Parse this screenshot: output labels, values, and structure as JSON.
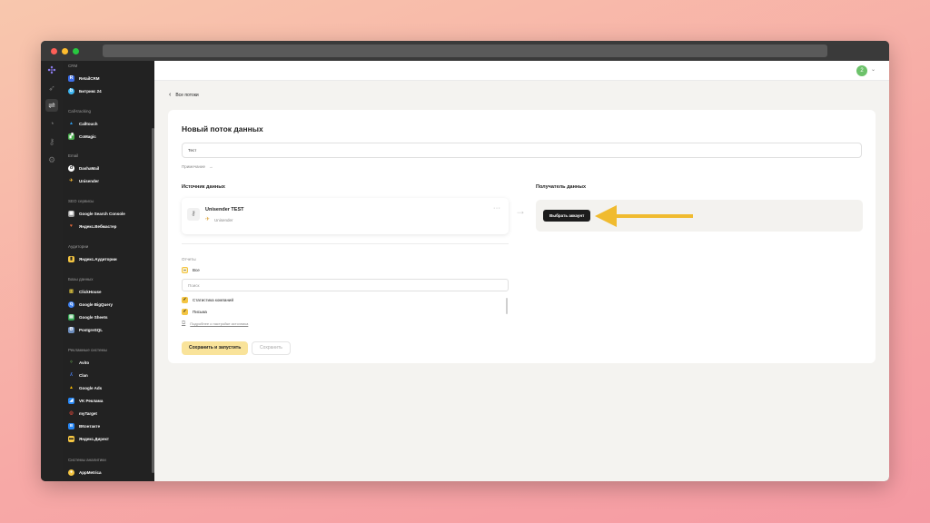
{
  "sidebar": {
    "groups": [
      {
        "title": "CRM",
        "items": [
          {
            "label": "RetailCRM",
            "icon": "retailcrm-icon",
            "color": "#3e6fe8"
          },
          {
            "label": "Битрикс 24",
            "icon": "bitrix24-icon",
            "color": "#3db6f2"
          }
        ]
      },
      {
        "title": "Call-tracking",
        "items": [
          {
            "label": "Calltouch",
            "icon": "calltouch-icon",
            "color": "#2f9be9"
          },
          {
            "label": "CoMagic",
            "icon": "comagic-icon",
            "color": "#4caf50"
          }
        ]
      },
      {
        "title": "Email",
        "items": [
          {
            "label": "DashaMail",
            "icon": "dashamail-icon",
            "color": "#ffffff"
          },
          {
            "label": "Unisender",
            "icon": "unisender-icon",
            "color": "#f2b632"
          }
        ]
      },
      {
        "title": "SEO сервисы",
        "items": [
          {
            "label": "Google Search Console",
            "icon": "google-search-console-icon",
            "color": "#9e9e9e"
          },
          {
            "label": "Яндекс.Вебмастер",
            "icon": "yandex-webmaster-icon",
            "color": "#e96a3b"
          }
        ]
      },
      {
        "title": "Аудитории",
        "items": [
          {
            "label": "Яндекс.Аудитории",
            "icon": "yandex-audience-icon",
            "color": "#f4c542"
          }
        ]
      },
      {
        "title": "Базы данных",
        "items": [
          {
            "label": "ClickHouse",
            "icon": "clickhouse-icon",
            "color": "#f4d742"
          },
          {
            "label": "Google BigQuery",
            "icon": "google-bigquery-icon",
            "color": "#4285f4"
          },
          {
            "label": "Google Sheets",
            "icon": "google-sheets-icon",
            "color": "#34a853"
          },
          {
            "label": "PostgreSQL",
            "icon": "postgresql-icon",
            "color": "#6f8fbf"
          }
        ]
      },
      {
        "title": "Рекламные системы",
        "items": [
          {
            "label": "Avito",
            "icon": "avito-icon",
            "color": "#72c05a"
          },
          {
            "label": "Clan",
            "icon": "clan-icon",
            "color": "#4a7dea"
          },
          {
            "label": "Google Ads",
            "icon": "google-ads-icon",
            "color": "#fbbc04"
          },
          {
            "label": "VK Реклама",
            "icon": "vk-ads-icon",
            "color": "#2787f5"
          },
          {
            "label": "myTarget",
            "icon": "mytarget-icon",
            "color": "#e94b3c"
          },
          {
            "label": "ВКонтакте",
            "icon": "vkontakte-icon",
            "color": "#2787f5"
          },
          {
            "label": "Яндекс.Директ",
            "icon": "yandex-direct-icon",
            "color": "#f4c542"
          }
        ]
      },
      {
        "title": "Системы аналитики",
        "items": [
          {
            "label": "AppMetrica",
            "icon": "appmetrica-icon",
            "color": "#f4c542"
          }
        ]
      }
    ]
  },
  "header": {
    "avatar_initial": "2"
  },
  "nav": {
    "back_label": "Все потоки"
  },
  "form": {
    "title": "Новый поток данных",
    "name_value": "Тест",
    "note_label": "Примечание",
    "source_title": "Источник данных",
    "destination_title": "Получатель данных",
    "source": {
      "name": "Unisender TEST",
      "service": "Unisender"
    },
    "pick_account_label": "Выбрать аккаунт",
    "reports_label": "Отчеты",
    "select_all_label": "Все",
    "search_placeholder": "Поиск",
    "reports": [
      {
        "label": "Статистика компаний",
        "checked": true
      },
      {
        "label": "Письма",
        "checked": true
      }
    ],
    "help_link": "Подробнее о настройке источника",
    "save_run_label": "Сохранить и запустить",
    "save_label": "Сохранить"
  },
  "colors": {
    "accent_yellow": "#f4c542",
    "annotation_arrow": "#f0bb2f",
    "primary_button": "#f9e39a",
    "sidebar_bg": "#222222"
  }
}
